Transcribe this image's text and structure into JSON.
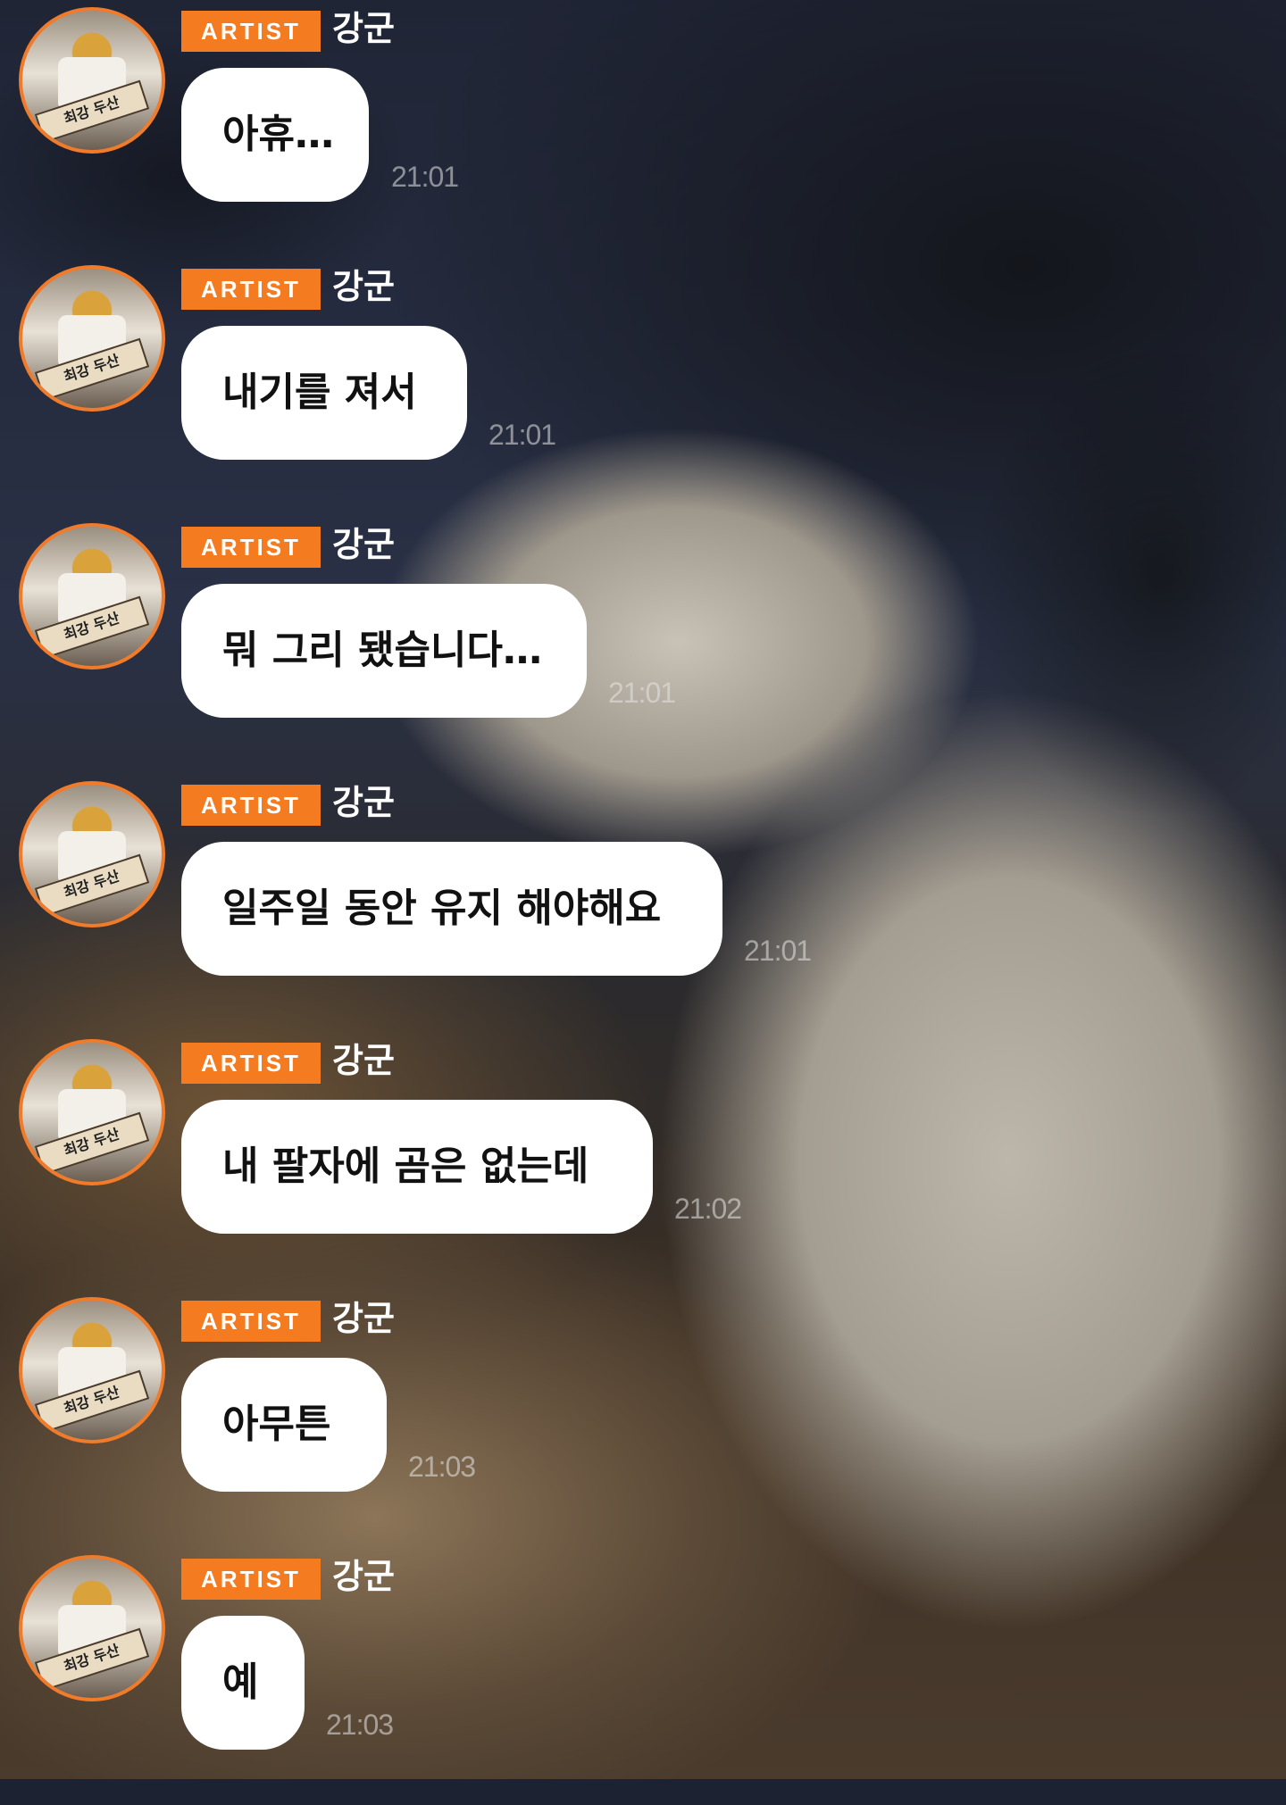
{
  "messages": [
    {
      "badge": "ARTIST",
      "name": "강군",
      "text": "아휴…",
      "time": "21:01"
    },
    {
      "badge": "ARTIST",
      "name": "강군",
      "text": "내기를 져서",
      "time": "21:01"
    },
    {
      "badge": "ARTIST",
      "name": "강군",
      "text": "뭐 그리 됐습니다…",
      "time": "21:01"
    },
    {
      "badge": "ARTIST",
      "name": "강군",
      "text": "일주일 동안 유지 해야해요",
      "time": "21:01"
    },
    {
      "badge": "ARTIST",
      "name": "강군",
      "text": "내 팔자에 곰은 없는데",
      "time": "21:02"
    },
    {
      "badge": "ARTIST",
      "name": "강군",
      "text": "아무튼",
      "time": "21:03"
    },
    {
      "badge": "ARTIST",
      "name": "강군",
      "text": "예",
      "time": "21:03"
    }
  ],
  "avatar_sign_text": "최강 두산",
  "colors": {
    "badge": "#f47b20",
    "avatar_ring": "#f07b2a",
    "bubble": "#ffffff"
  }
}
